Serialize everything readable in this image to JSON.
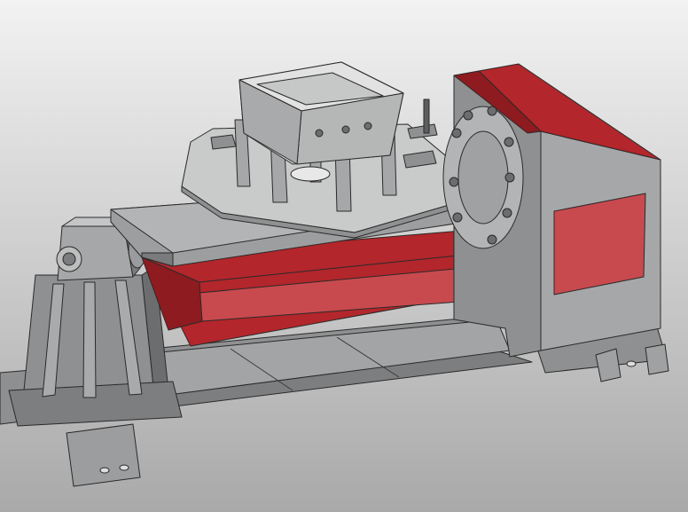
{
  "viewport": {
    "background_top": "#f2f2f2",
    "background_bottom": "#a9a9a9"
  },
  "model": {
    "subject": "welding-positioner-cad-render",
    "colors": {
      "body_gray": "#8f9091",
      "body_gray_light": "#b3b4b5",
      "body_gray_dark": "#6c6d6e",
      "accent_red": "#b3262b",
      "accent_red_dark": "#8d1b20",
      "accent_red_light": "#c84a4e",
      "outline": "#2a2a2a",
      "fixture_gray": "#c9caca"
    }
  }
}
